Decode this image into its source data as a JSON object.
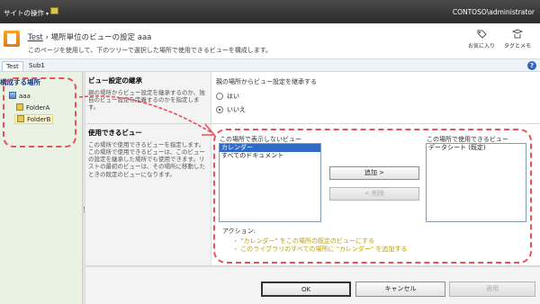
{
  "ribbon": {
    "site_actions": "サイトの操作",
    "site_actions_arrow": "▾",
    "user": "CONTOSO\\administrator"
  },
  "title": {
    "site_link": "Test",
    "separator": "›",
    "page_title": "場所単位のビューの設定 aaa",
    "description": "このページを使用して、下のツリーで選択した場所で使用できるビューを構成します。",
    "tools": [
      {
        "label": "お気に入り",
        "icon": "tag-icon"
      },
      {
        "label": "タグとメモ",
        "icon": "notes-icon"
      }
    ]
  },
  "tabs": [
    {
      "label": "Test",
      "active": true
    },
    {
      "label": "Sub1",
      "active": false
    }
  ],
  "help": "?",
  "nav": {
    "heading": "構成する場所",
    "root": "aaa",
    "children": [
      "FolderA",
      "FolderB"
    ],
    "selected": "FolderB"
  },
  "inherit_section": {
    "heading": "ビュー設定の継承",
    "description": "親の場所からビュー設定を継承するのか、独自のビュー設定を定義するのかを指定します。",
    "question": "親の場所からビュー設定を継承する",
    "options": [
      {
        "label": "はい",
        "checked": false
      },
      {
        "label": "いいえ",
        "checked": true
      }
    ]
  },
  "views_section": {
    "heading": "使用できるビュー",
    "description": "この場所で使用できるビューを指定します。この場所で使用できるビューは、このビューの設定を継承した場所でも使用できます。リストの最初のビューは、その場所に移動したときの既定のビューになります。",
    "hidden_label": "この場所で表示しないビュー",
    "hidden_items": [
      {
        "label": "カレンダー",
        "selected": true
      },
      {
        "label": "すべてのドキュメント",
        "selected": false
      }
    ],
    "available_label": "この場所で使用できるビュー",
    "available_items": [
      "データシート (既定)"
    ],
    "add_button": "追加 >",
    "remove_button": "< 削除",
    "actions_label": "アクション:",
    "actions": [
      "\"カレンダー\" をこの場所の既定のビューにする",
      "このライブラリのすべての場所に \"カレンダー\" を追加する"
    ]
  },
  "footer": {
    "ok": "OK",
    "cancel": "キャンセル",
    "apply": "適用"
  },
  "colors": {
    "annotation": "#e8505b",
    "nav_bg": "#eaf2e3",
    "selection": "#316ac5"
  }
}
